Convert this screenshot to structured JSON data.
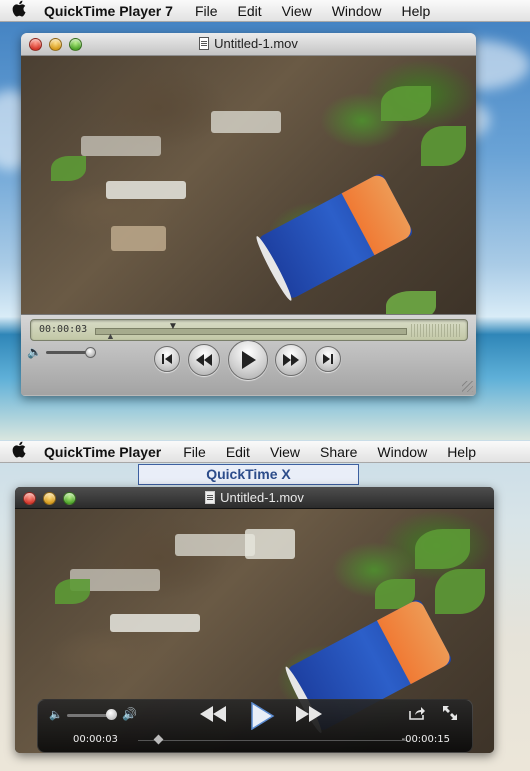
{
  "menubar_qt7": {
    "app_name": "QuickTime Player 7",
    "items": [
      "File",
      "Edit",
      "View",
      "Window",
      "Help"
    ]
  },
  "qt7_window": {
    "title": "Untitled-1.mov",
    "time": "00:00:03"
  },
  "menubar_qtx": {
    "app_name": "QuickTime Player",
    "items": [
      "File",
      "Edit",
      "View",
      "Share",
      "Window",
      "Help"
    ]
  },
  "qtx_label": "QuickTime X",
  "qtx_window": {
    "title": "Untitled-1.mov",
    "time_elapsed": "00:00:03",
    "time_remaining": "-00:00:15"
  },
  "icons": {
    "apple": "apple-icon",
    "rewind": "rewind-icon",
    "play": "play-icon",
    "fast_forward": "fast-forward-icon",
    "skip_back": "skip-to-start-icon",
    "skip_forward": "skip-to-end-icon",
    "share": "share-icon",
    "fullscreen": "fullscreen-icon"
  }
}
